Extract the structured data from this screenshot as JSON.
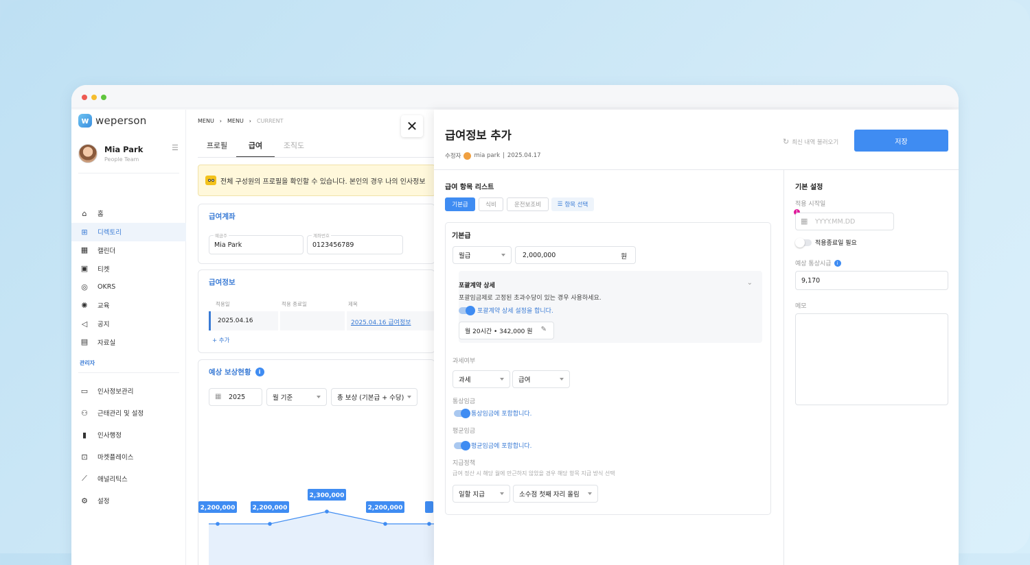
{
  "app": {
    "logo_text": "weperson"
  },
  "user": {
    "name": "Mia Park",
    "team": "People Team"
  },
  "nav": {
    "items": [
      {
        "label": "홈",
        "icon": "home-icon"
      },
      {
        "label": "디렉토리",
        "icon": "org-chart-icon"
      },
      {
        "label": "캘린더",
        "icon": "calendar-icon"
      },
      {
        "label": "티켓",
        "icon": "ticket-icon"
      },
      {
        "label": "OKRS",
        "icon": "target-icon"
      },
      {
        "label": "교육",
        "icon": "bulb-icon"
      },
      {
        "label": "공지",
        "icon": "megaphone-icon"
      },
      {
        "label": "자료실",
        "icon": "archive-icon"
      }
    ],
    "admin_label": "관리자",
    "admin_items": [
      {
        "label": "인사정보관리",
        "icon": "id-card-icon"
      },
      {
        "label": "근태관리 및 설정",
        "icon": "user-gear-icon"
      },
      {
        "label": "인사행정",
        "icon": "document-icon"
      },
      {
        "label": "마켓플레이스",
        "icon": "gift-icon"
      },
      {
        "label": "애널리틱스",
        "icon": "chart-icon"
      },
      {
        "label": "설정",
        "icon": "gear-icon"
      }
    ]
  },
  "main": {
    "breadcrumb": [
      "MENU",
      "MENU",
      "CURRENT"
    ],
    "tabs": [
      "프로필",
      "급여",
      "조직도"
    ],
    "notice": "전체 구성원의 프로필을 확인할 수 있습니다. 본인의 경우 나의 인사정보",
    "account": {
      "title": "급여계좌",
      "holder_label": "예금주",
      "holder": "Mia Park",
      "number_label": "계좌번호",
      "number": "0123456789"
    },
    "salary": {
      "title": "급여정보",
      "headers": [
        "적용일",
        "적용 종료일",
        "제목"
      ],
      "row": {
        "start": "2025.04.16",
        "end": "",
        "title": "2025.04.16 급여정보"
      },
      "add": "+ 추가"
    },
    "forecast": {
      "title": "예상 보상현황",
      "year": "2025",
      "basis": "월 기준",
      "type": "총 보상 (기본급 + 수당)"
    }
  },
  "chart_data": {
    "type": "line",
    "categories": [
      "",
      "",
      "",
      "",
      ""
    ],
    "values": [
      2200000,
      2200000,
      2300000,
      2200000,
      2200000
    ],
    "labels": [
      "2,200,000",
      "2,200,000",
      "2,300,000",
      "2,200,000",
      ""
    ],
    "title": "",
    "xlabel": "",
    "ylabel": ""
  },
  "panel": {
    "title": "급여정보 추가",
    "meta_prefix": "수정자",
    "meta_user": "mia park",
    "meta_date": "2025.04.17",
    "recent": "최신 내역 불러오기",
    "save": "저장",
    "list_title": "급여 항목 리스트",
    "chips": [
      "기본급",
      "식비",
      "운전보조비",
      "항목 선택"
    ],
    "item_title": "기본급",
    "pay_type": "월급",
    "amount": "2,000,000",
    "unit": "원",
    "package_title": "포괄계약 상세",
    "package_desc": "포괄임금제로 고정된 초과수당이 있는 경우 사용하세요.",
    "package_toggle": "포괄계약 상세 설정을 합니다.",
    "package_value": "월 20시간 • 342,000 원",
    "tax_label": "과세여부",
    "tax": "과세",
    "tax_type": "급여",
    "ordinary_label": "통상임금",
    "ordinary_toggle": "통상임금에 포함합니다.",
    "average_label": "평균임금",
    "average_toggle": "평균임금에 포함합니다.",
    "policy_label": "지급정책",
    "policy_desc": "급여 정산 시 해당 월에 만근하지 않았을 경우 해당 항목 지급 방식 선택",
    "policy": "일할 지급",
    "rounding": "소수점 첫째 자리 올림",
    "basic": {
      "title": "기본 설정",
      "start_label": "적용 시작일",
      "start_placeholder": "YYYY.MM.DD",
      "end_toggle": "적용종료일 필요",
      "hourly_label": "예상 통상시급",
      "hourly": "9,170",
      "memo_label": "메모"
    }
  }
}
